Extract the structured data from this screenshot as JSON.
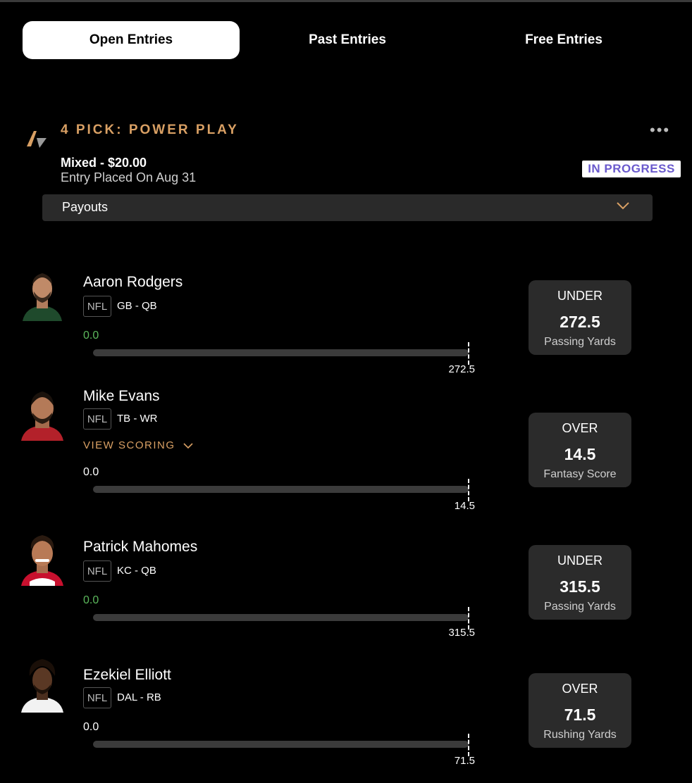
{
  "tabs": [
    {
      "label": "Open Entries",
      "active": true
    },
    {
      "label": "Past Entries",
      "active": false
    },
    {
      "label": "Free Entries",
      "active": false
    }
  ],
  "entry": {
    "title": "4 PICK: POWER PLAY",
    "amount": "Mixed - $20.00",
    "placed": "Entry Placed On Aug 31",
    "status": "IN PROGRESS",
    "more_icon": "ellipsis-icon",
    "payouts_label": "Payouts"
  },
  "players": [
    {
      "name": "Aaron Rodgers",
      "league": "NFL",
      "team": "GB - QB",
      "score": "0.0",
      "line_label": "272.5",
      "direction": "UNDER",
      "line": "272.5",
      "stat": "Passing Yards",
      "jersey": "#1f4a2c",
      "progress": 0
    },
    {
      "name": "Mike Evans",
      "league": "NFL",
      "team": "TB - WR",
      "view_scoring": "VIEW SCORING",
      "score": "0.0",
      "line_label": "14.5",
      "direction": "OVER",
      "line": "14.5",
      "stat": "Fantasy Score",
      "jersey": "#b3212a",
      "progress": 0
    },
    {
      "name": "Patrick Mahomes",
      "league": "NFL",
      "team": "KC - QB",
      "score": "0.0",
      "line_label": "315.5",
      "direction": "UNDER",
      "line": "315.5",
      "stat": "Passing Yards",
      "jersey": "#c8102e",
      "progress": 0
    },
    {
      "name": "Ezekiel Elliott",
      "league": "NFL",
      "team": "DAL - RB",
      "score": "0.0",
      "line_label": "71.5",
      "direction": "OVER",
      "line": "71.5",
      "stat": "Rushing Yards",
      "jersey": "#f2f2f2",
      "progress": 0
    }
  ],
  "colors": {
    "accent": "#d9a064",
    "status": "#6a5acd",
    "score_green": "#5cb85c"
  }
}
